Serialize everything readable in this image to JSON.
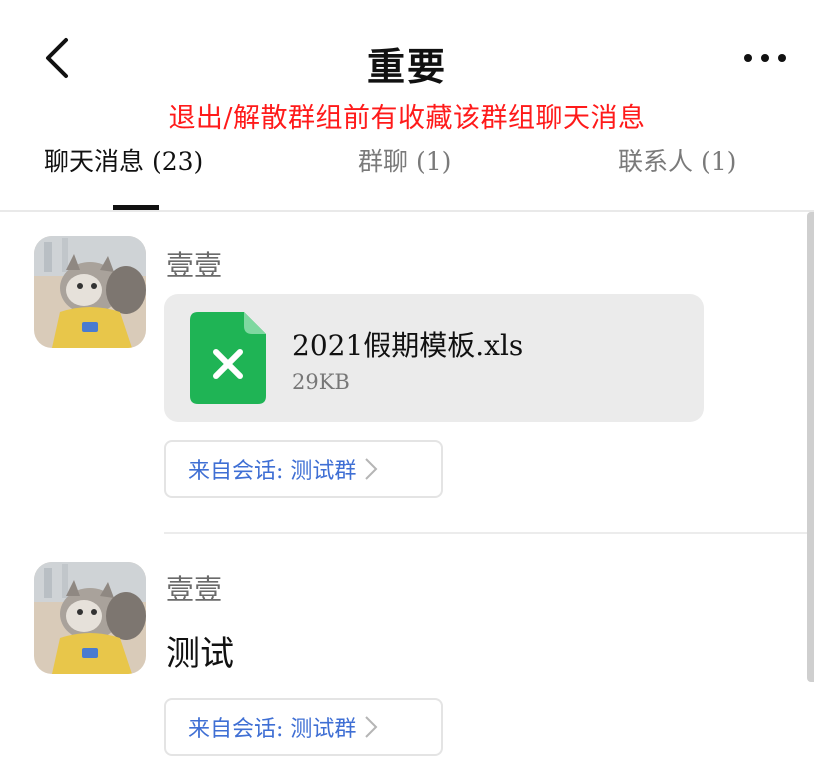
{
  "header": {
    "title": "重要",
    "notice": "退出/解散群组前有收藏该群组聊天消息",
    "back_icon": "chevron-left-icon",
    "more_icon": "more-horizontal-icon"
  },
  "tabs": [
    {
      "label": "聊天消息 (23)",
      "active": true
    },
    {
      "label": "群聊 (1)",
      "active": false
    },
    {
      "label": "联系人 (1)",
      "active": false
    }
  ],
  "messages": [
    {
      "sender": "壹壹",
      "type": "file",
      "file": {
        "name": "2021假期模板.xls",
        "size": "29KB",
        "icon": "excel-file-icon",
        "icon_color": "#1fb455"
      },
      "source": "来自会话: 测试群"
    },
    {
      "sender": "壹壹",
      "type": "text",
      "text": "测试",
      "source": "来自会话: 测试群"
    }
  ],
  "colors": {
    "notice": "#ff1a1a",
    "link": "#3f6fd4",
    "card_bg": "#ebebeb"
  }
}
